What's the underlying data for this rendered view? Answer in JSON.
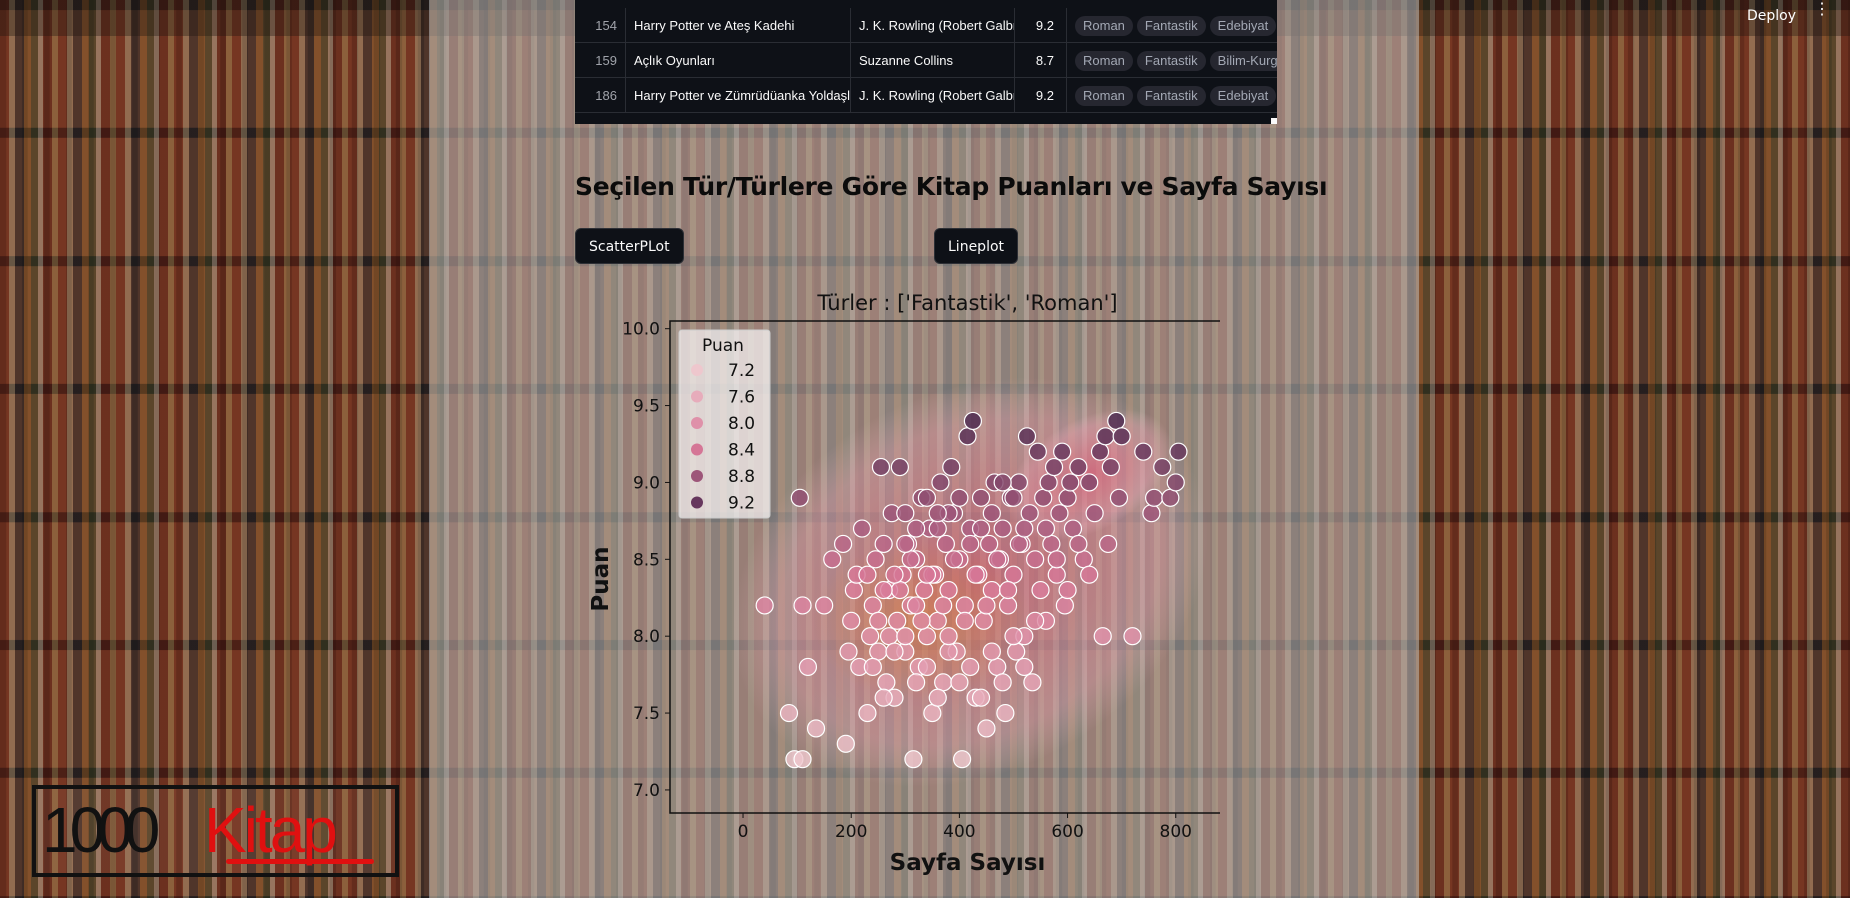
{
  "header": {
    "deploy_label": "Deploy",
    "menu_icon": "kebab-menu-icon"
  },
  "table": {
    "rows": [
      {
        "id": "154",
        "title": "Harry Potter ve Ateş Kadehi",
        "author": "J. K. Rowling (Robert Galbr",
        "score": "9.2",
        "tags": [
          "Roman",
          "Fantastik",
          "Edebiyat"
        ]
      },
      {
        "id": "159",
        "title": "Açlık Oyunları",
        "author": "Suzanne Collins",
        "score": "8.7",
        "tags": [
          "Roman",
          "Fantastik",
          "Bilim-Kurg"
        ]
      },
      {
        "id": "186",
        "title": "Harry Potter ve Zümrüdüanka Yoldaşl",
        "author": "J. K. Rowling (Robert Galbr",
        "score": "9.2",
        "tags": [
          "Roman",
          "Fantastik",
          "Edebiyat"
        ]
      }
    ]
  },
  "section": {
    "title": "Seçilen Tür/Türlere Göre Kitap Puanları ve Sayfa Sayısı",
    "scatter_button": "ScatterPLot",
    "line_button": "Lineplot"
  },
  "logo": {
    "part1": "1000",
    "part2": "Kitap"
  },
  "colors": {
    "table_bg": "#0e1117",
    "button_bg": "#0e1117",
    "point_low": "#f2d4d6",
    "point_high": "#3d1f47",
    "kde_fill": "#e8a0b0"
  },
  "chart_data": {
    "type": "scatter",
    "title": "Türler : ['Fantastik', 'Roman']",
    "xlabel": "Sayfa Sayısı",
    "ylabel": "Puan",
    "xlim": [
      -135,
      965
    ],
    "ylim": [
      6.85,
      10.05
    ],
    "xticks": [
      "0",
      "200",
      "400",
      "600",
      "800"
    ],
    "yticks": [
      "7.0",
      "7.5",
      "8.0",
      "8.5",
      "9.0",
      "9.5",
      "10.0"
    ],
    "legend": {
      "title": "Puan",
      "placement": "top-left",
      "entries": [
        "7.2",
        "7.6",
        "8.0",
        "8.4",
        "8.8",
        "9.2"
      ]
    },
    "grid": false,
    "hue": "Puan",
    "points": [
      [
        40,
        8.2
      ],
      [
        105,
        8.9
      ],
      [
        110,
        8.2
      ],
      [
        120,
        7.8
      ],
      [
        85,
        7.5
      ],
      [
        95,
        7.2
      ],
      [
        110,
        7.2
      ],
      [
        135,
        7.4
      ],
      [
        150,
        8.2
      ],
      [
        165,
        8.5
      ],
      [
        185,
        8.6
      ],
      [
        190,
        7.3
      ],
      [
        195,
        7.9
      ],
      [
        200,
        8.1
      ],
      [
        205,
        8.3
      ],
      [
        210,
        8.4
      ],
      [
        215,
        7.8
      ],
      [
        220,
        8.7
      ],
      [
        230,
        7.5
      ],
      [
        235,
        8.0
      ],
      [
        240,
        8.2
      ],
      [
        245,
        8.5
      ],
      [
        250,
        7.9
      ],
      [
        255,
        9.1
      ],
      [
        260,
        8.6
      ],
      [
        265,
        7.7
      ],
      [
        270,
        8.3
      ],
      [
        275,
        8.8
      ],
      [
        280,
        7.6
      ],
      [
        285,
        8.1
      ],
      [
        290,
        9.1
      ],
      [
        295,
        8.4
      ],
      [
        300,
        7.9
      ],
      [
        305,
        8.6
      ],
      [
        310,
        8.2
      ],
      [
        315,
        7.2
      ],
      [
        320,
        8.5
      ],
      [
        325,
        7.8
      ],
      [
        330,
        8.9
      ],
      [
        335,
        8.3
      ],
      [
        340,
        8.0
      ],
      [
        345,
        8.7
      ],
      [
        350,
        7.5
      ],
      [
        355,
        8.4
      ],
      [
        360,
        8.1
      ],
      [
        365,
        9.0
      ],
      [
        370,
        7.7
      ],
      [
        375,
        8.6
      ],
      [
        380,
        8.3
      ],
      [
        385,
        9.1
      ],
      [
        390,
        8.8
      ],
      [
        395,
        7.9
      ],
      [
        400,
        8.5
      ],
      [
        405,
        7.2
      ],
      [
        410,
        8.2
      ],
      [
        415,
        9.3
      ],
      [
        420,
        8.7
      ],
      [
        425,
        9.4
      ],
      [
        430,
        7.6
      ],
      [
        435,
        8.4
      ],
      [
        440,
        8.9
      ],
      [
        445,
        8.1
      ],
      [
        450,
        7.4
      ],
      [
        455,
        8.6
      ],
      [
        460,
        8.3
      ],
      [
        465,
        9.0
      ],
      [
        470,
        7.8
      ],
      [
        475,
        8.5
      ],
      [
        480,
        8.7
      ],
      [
        485,
        7.5
      ],
      [
        490,
        8.2
      ],
      [
        495,
        8.9
      ],
      [
        500,
        8.4
      ],
      [
        505,
        7.9
      ],
      [
        510,
        9.0
      ],
      [
        515,
        8.6
      ],
      [
        520,
        8.0
      ],
      [
        525,
        9.3
      ],
      [
        530,
        8.8
      ],
      [
        535,
        7.7
      ],
      [
        540,
        8.5
      ],
      [
        545,
        9.2
      ],
      [
        550,
        8.3
      ],
      [
        555,
        8.9
      ],
      [
        560,
        8.1
      ],
      [
        565,
        9.0
      ],
      [
        570,
        8.6
      ],
      [
        575,
        9.1
      ],
      [
        580,
        8.4
      ],
      [
        585,
        8.8
      ],
      [
        590,
        9.2
      ],
      [
        595,
        8.2
      ],
      [
        600,
        8.9
      ],
      [
        605,
        9.0
      ],
      [
        610,
        8.7
      ],
      [
        620,
        9.1
      ],
      [
        630,
        8.5
      ],
      [
        640,
        9.0
      ],
      [
        650,
        8.8
      ],
      [
        660,
        9.2
      ],
      [
        665,
        8.0
      ],
      [
        670,
        9.3
      ],
      [
        675,
        8.6
      ],
      [
        680,
        9.1
      ],
      [
        690,
        9.4
      ],
      [
        695,
        8.9
      ],
      [
        700,
        9.3
      ],
      [
        720,
        8.0
      ],
      [
        740,
        9.2
      ],
      [
        755,
        8.8
      ],
      [
        760,
        8.9
      ],
      [
        775,
        9.1
      ],
      [
        790,
        8.9
      ],
      [
        800,
        9.0
      ],
      [
        805,
        9.2
      ],
      [
        230,
        8.4
      ],
      [
        250,
        8.1
      ],
      [
        270,
        8.0
      ],
      [
        290,
        8.3
      ],
      [
        310,
        8.5
      ],
      [
        330,
        8.1
      ],
      [
        350,
        8.4
      ],
      [
        370,
        8.2
      ],
      [
        390,
        8.5
      ],
      [
        410,
        8.1
      ],
      [
        430,
        8.4
      ],
      [
        450,
        8.2
      ],
      [
        470,
        8.5
      ],
      [
        490,
        8.3
      ],
      [
        510,
        8.6
      ],
      [
        260,
        7.6
      ],
      [
        280,
        7.9
      ],
      [
        300,
        8.0
      ],
      [
        320,
        7.7
      ],
      [
        340,
        7.8
      ],
      [
        360,
        7.6
      ],
      [
        380,
        7.9
      ],
      [
        400,
        7.7
      ],
      [
        420,
        7.8
      ],
      [
        440,
        7.6
      ],
      [
        460,
        7.9
      ],
      [
        480,
        7.7
      ],
      [
        500,
        8.0
      ],
      [
        520,
        7.8
      ],
      [
        540,
        8.1
      ],
      [
        560,
        8.7
      ],
      [
        580,
        8.5
      ],
      [
        600,
        8.3
      ],
      [
        620,
        8.6
      ],
      [
        640,
        8.4
      ],
      [
        300,
        8.8
      ],
      [
        320,
        8.7
      ],
      [
        340,
        8.9
      ],
      [
        360,
        8.7
      ],
      [
        380,
        8.8
      ],
      [
        400,
        8.9
      ],
      [
        420,
        8.6
      ],
      [
        440,
        8.7
      ],
      [
        460,
        8.8
      ],
      [
        480,
        9.0
      ],
      [
        500,
        8.9
      ],
      [
        520,
        8.7
      ],
      [
        240,
        7.8
      ],
      [
        260,
        8.3
      ],
      [
        280,
        8.4
      ],
      [
        300,
        8.6
      ],
      [
        320,
        8.2
      ],
      [
        340,
        8.4
      ],
      [
        360,
        8.8
      ],
      [
        380,
        8.0
      ]
    ]
  }
}
